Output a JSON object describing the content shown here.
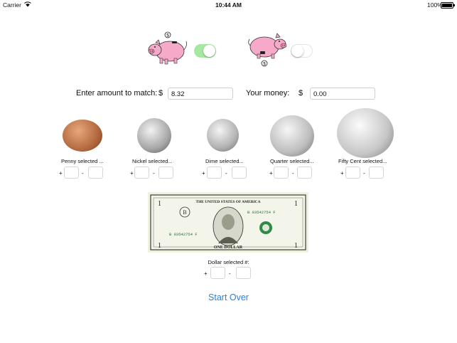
{
  "status_bar": {
    "carrier": "Carrier",
    "time": "10:44 AM",
    "battery": "100%"
  },
  "pig_left_coin_symbol": "$",
  "pig_right_coin_symbol": "$",
  "toggles": {
    "left_state": "on",
    "right_state": "off"
  },
  "match": {
    "label": "Enter amount to match:",
    "currency": "$",
    "value": "8.32"
  },
  "your_money": {
    "label": "Your money:",
    "currency": "$",
    "value": "0.00"
  },
  "coins": [
    {
      "label": "Penny selected ...",
      "plus": "+",
      "minus": "-"
    },
    {
      "label": "Nickel selected...",
      "plus": "+",
      "minus": "-"
    },
    {
      "label": "Dime selected...",
      "plus": "+",
      "minus": "-"
    },
    {
      "label": "Quarter selected...",
      "plus": "+",
      "minus": "-"
    },
    {
      "label": "Fifty Cent selected...",
      "plus": "+",
      "minus": "-"
    }
  ],
  "dollar": {
    "label": "Dollar selected #:",
    "plus": "+",
    "minus": "-",
    "bill_text_top": "THE UNITED STATES OF AMERICA",
    "serial": "B 03542754 F",
    "bill_bottom_text": "ONE DOLLAR",
    "bill_denomination": "1"
  },
  "start_over": "Start Over",
  "colors": {
    "accent": "#2b7fd6",
    "pig_pink": "#f6a9c8",
    "toggle_green": "#a5e8a0"
  }
}
